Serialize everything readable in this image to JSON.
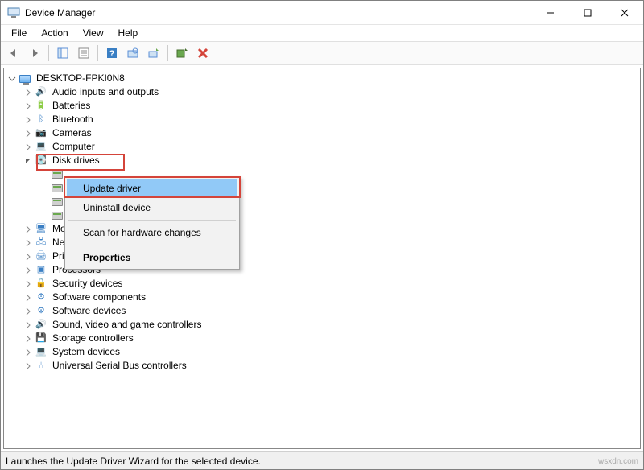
{
  "window": {
    "title": "Device Manager"
  },
  "menubar": {
    "items": [
      "File",
      "Action",
      "View",
      "Help"
    ]
  },
  "tree": {
    "root": "DESKTOP-FPKI0N8",
    "categories": [
      {
        "label": "Audio inputs and outputs",
        "expanded": false
      },
      {
        "label": "Batteries",
        "expanded": false
      },
      {
        "label": "Bluetooth",
        "expanded": false
      },
      {
        "label": "Cameras",
        "expanded": false
      },
      {
        "label": "Computer",
        "expanded": false
      },
      {
        "label": "Disk drives",
        "expanded": true,
        "highlight": true,
        "children": [
          "",
          "",
          "",
          ""
        ]
      },
      {
        "label": "Monitors",
        "expanded": false
      },
      {
        "label": "Network adapters",
        "expanded": false
      },
      {
        "label": "Print queues",
        "expanded": false
      },
      {
        "label": "Processors",
        "expanded": false
      },
      {
        "label": "Security devices",
        "expanded": false
      },
      {
        "label": "Software components",
        "expanded": false
      },
      {
        "label": "Software devices",
        "expanded": false
      },
      {
        "label": "Sound, video and game controllers",
        "expanded": false
      },
      {
        "label": "Storage controllers",
        "expanded": false
      },
      {
        "label": "System devices",
        "expanded": false
      },
      {
        "label": "Universal Serial Bus controllers",
        "expanded": false
      }
    ]
  },
  "context_menu": {
    "items": [
      {
        "label": "Update driver",
        "hover": true
      },
      {
        "label": "Uninstall device"
      },
      {
        "sep": true
      },
      {
        "label": "Scan for hardware changes"
      },
      {
        "sep": true
      },
      {
        "label": "Properties",
        "bold": true
      }
    ]
  },
  "statusbar": {
    "text": "Launches the Update Driver Wizard for the selected device."
  },
  "watermark": "wsxdn.com"
}
